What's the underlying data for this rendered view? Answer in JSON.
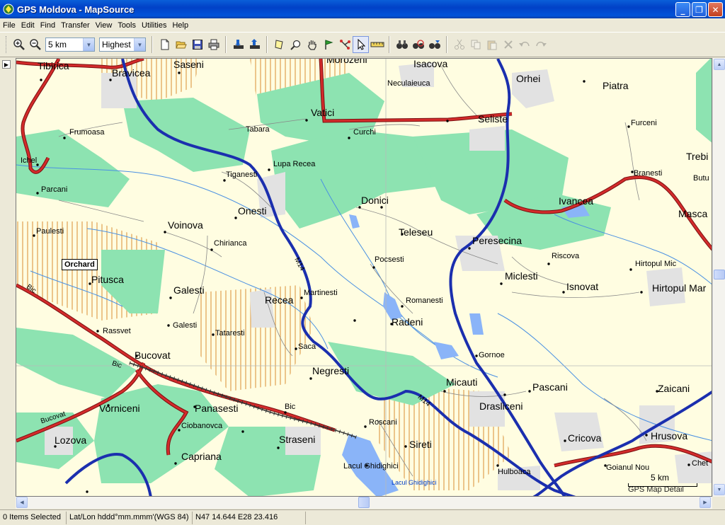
{
  "window": {
    "title": "GPS Moldova - MapSource",
    "controls": {
      "minimize": "_",
      "restore": "❐",
      "close": "✕"
    }
  },
  "menu": [
    "File",
    "Edit",
    "Find",
    "Transfer",
    "View",
    "Tools",
    "Utilities",
    "Help"
  ],
  "toolbar": {
    "zoom_scale": "5 km",
    "detail_level": "Highest",
    "buttons": [
      "zoom-in-icon",
      "zoom-out-icon",
      "new-icon",
      "open-icon",
      "save-icon",
      "print-icon",
      "receive-icon",
      "send-icon",
      "select-map-tool-icon",
      "zoom-tool-icon",
      "hand-tool-icon",
      "waypoint-tool-icon",
      "route-tool-icon",
      "selection-tool-icon",
      "distance-tool-icon",
      "find-icon",
      "find-nearest-icon",
      "find-places-icon",
      "cut-icon",
      "copy-icon",
      "paste-icon",
      "delete-icon",
      "undo-icon",
      "redo-icon"
    ],
    "active_tool": "selection-tool-icon"
  },
  "map": {
    "labels": [
      {
        "text": "Tibirica",
        "cls": "big"
      },
      {
        "text": "Bravicea",
        "cls": "big"
      },
      {
        "text": "Saseni",
        "cls": "big"
      },
      {
        "text": "Morozeni",
        "cls": "big"
      },
      {
        "text": "Isacova",
        "cls": "big"
      },
      {
        "text": "Orhei",
        "cls": "big"
      },
      {
        "text": "Neculaieuca",
        "cls": "small"
      },
      {
        "text": "Piatra",
        "cls": "big"
      },
      {
        "text": "Vatici",
        "cls": "big"
      },
      {
        "text": "Seliste",
        "cls": "big"
      },
      {
        "text": "Tabara",
        "cls": "small"
      },
      {
        "text": "Curchi",
        "cls": "small"
      },
      {
        "text": "Frumoasa",
        "cls": "small"
      },
      {
        "text": "Furceni",
        "cls": "small"
      },
      {
        "text": "Ichel",
        "cls": "small"
      },
      {
        "text": "Trebi",
        "cls": "big"
      },
      {
        "text": "Lupa Recea",
        "cls": "small"
      },
      {
        "text": "Tiganesti",
        "cls": "small"
      },
      {
        "text": "Branesti",
        "cls": "small"
      },
      {
        "text": "Butu",
        "cls": "small"
      },
      {
        "text": "Parcani",
        "cls": "small"
      },
      {
        "text": "Donici",
        "cls": "big"
      },
      {
        "text": "Ivancea",
        "cls": "big"
      },
      {
        "text": "Onesti",
        "cls": "big"
      },
      {
        "text": "Masca",
        "cls": "big"
      },
      {
        "text": "Paulesti",
        "cls": "small"
      },
      {
        "text": "Voinova",
        "cls": "big"
      },
      {
        "text": "Teleseu",
        "cls": "big"
      },
      {
        "text": "Peresecina",
        "cls": "big"
      },
      {
        "text": "Chirianca",
        "cls": "small"
      },
      {
        "text": "Riscova",
        "cls": "small"
      },
      {
        "text": "Pocsesti",
        "cls": "small"
      },
      {
        "text": "Hirtopul Mic",
        "cls": "small"
      },
      {
        "text": "Pitusca",
        "cls": "big"
      },
      {
        "text": "Miclesti",
        "cls": "big"
      },
      {
        "text": "Isnovat",
        "cls": "big"
      },
      {
        "text": "Hirtopul Mar",
        "cls": "big"
      },
      {
        "text": "Galesti",
        "cls": "big"
      },
      {
        "text": "Martinesti",
        "cls": "small"
      },
      {
        "text": "Recea",
        "cls": "big"
      },
      {
        "text": "Romanesti",
        "cls": "small"
      },
      {
        "text": "Radeni",
        "cls": "big"
      },
      {
        "text": "Galesti",
        "cls": "small"
      },
      {
        "text": "Rassvet",
        "cls": "small"
      },
      {
        "text": "Tataresti",
        "cls": "small"
      },
      {
        "text": "Saca",
        "cls": "small"
      },
      {
        "text": "Gornoe",
        "cls": "small"
      },
      {
        "text": "Bucovat",
        "cls": "big"
      },
      {
        "text": "Negresti",
        "cls": "big"
      },
      {
        "text": "Micauti",
        "cls": "big"
      },
      {
        "text": "Pascani",
        "cls": "big"
      },
      {
        "text": "Zaicani",
        "cls": "big"
      },
      {
        "text": "Drasliceni",
        "cls": "big"
      },
      {
        "text": "Vorniceni",
        "cls": "big"
      },
      {
        "text": "Panasesti",
        "cls": "big"
      },
      {
        "text": "Bic",
        "cls": "small"
      },
      {
        "text": "Roscani",
        "cls": "small"
      },
      {
        "text": "Ciobanovca",
        "cls": "small"
      },
      {
        "text": "Lozova",
        "cls": "big"
      },
      {
        "text": "Straseni",
        "cls": "big"
      },
      {
        "text": "Sireti",
        "cls": "big"
      },
      {
        "text": "Cricova",
        "cls": "big"
      },
      {
        "text": "Hrusova",
        "cls": "big"
      },
      {
        "text": "Capriana",
        "cls": "big"
      },
      {
        "text": "Lacul Ghidighici",
        "cls": "small"
      },
      {
        "text": "Hulboaca",
        "cls": "small"
      },
      {
        "text": "Goianul Nou",
        "cls": "small"
      },
      {
        "text": "Chet",
        "cls": "small"
      },
      {
        "text": "Lacul Ghidighici",
        "cls": "lake"
      },
      {
        "text": "M14",
        "cls": "road"
      },
      {
        "text": "M14",
        "cls": "road"
      },
      {
        "text": "Bic",
        "cls": "road"
      },
      {
        "text": "Bic",
        "cls": "road"
      },
      {
        "text": "Bucovat",
        "cls": "road"
      }
    ],
    "poi": "Orchard",
    "scale": {
      "text": "5 km",
      "detail": "GPS Map Detail"
    }
  },
  "status": {
    "selection": "0 Items Selected",
    "coord_format": "Lat/Lon hddd°mm.mmm'(WGS 84)",
    "position": "N47 14.644 E28 23.416"
  }
}
